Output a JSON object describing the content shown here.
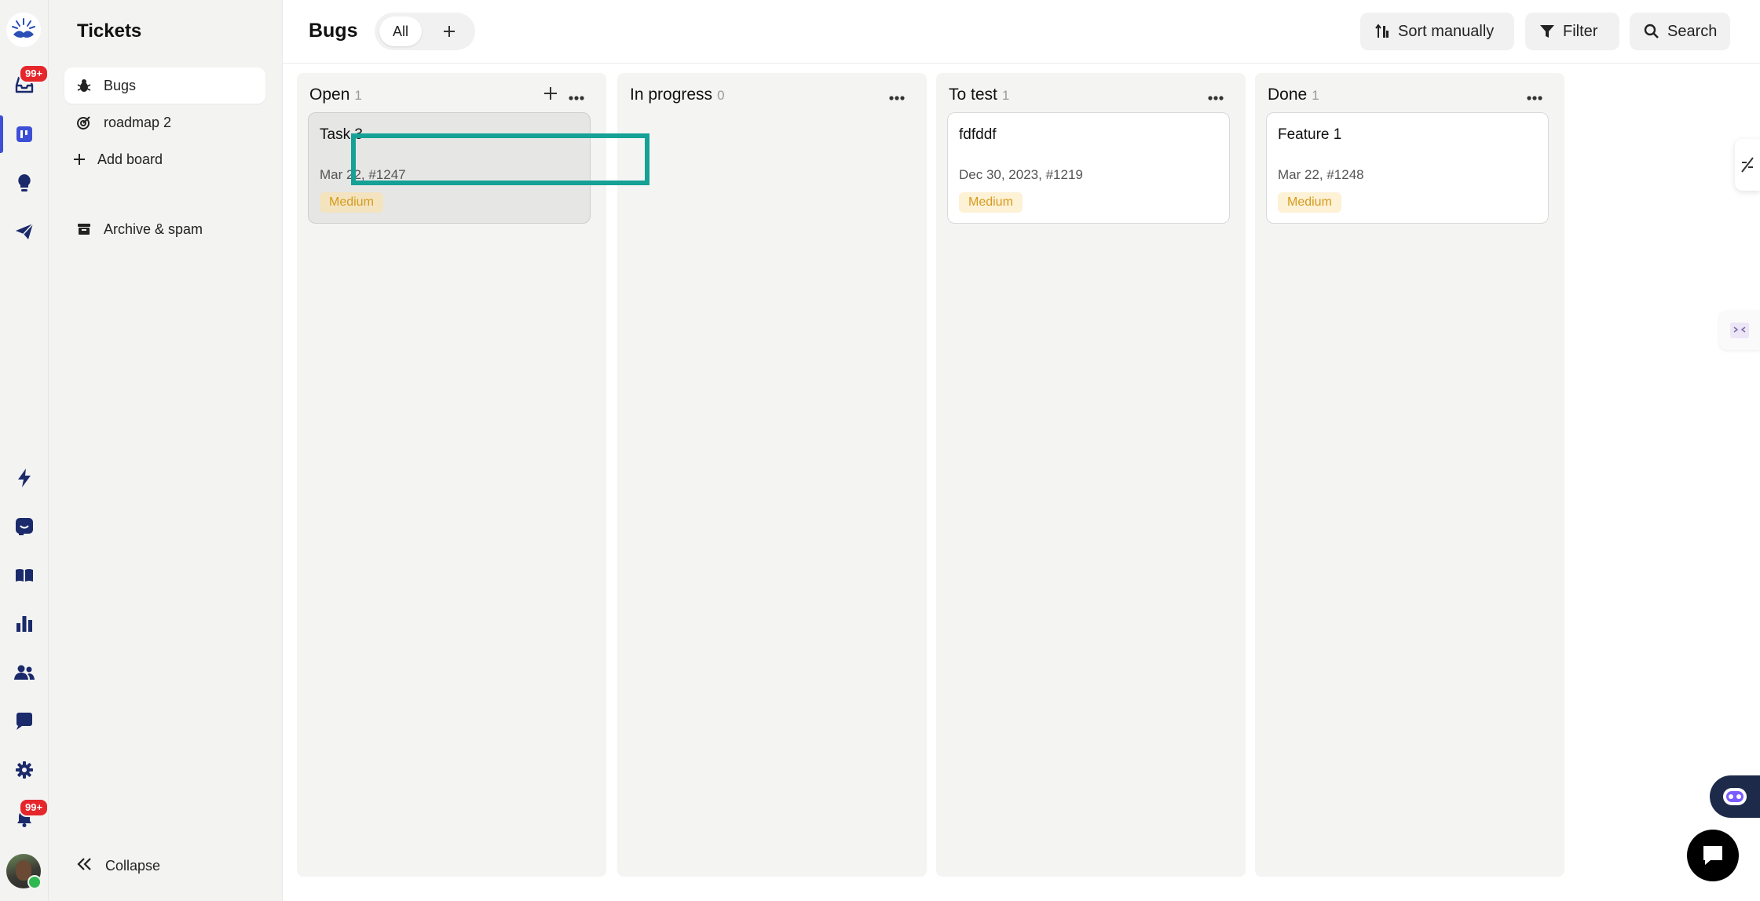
{
  "rail": {
    "inbox_badge": "99+",
    "notifications_badge": "99+",
    "icons": [
      "logo-icon",
      "inbox-icon",
      "board-icon",
      "lightbulb-icon",
      "send-icon",
      "bolt-icon",
      "smiley-icon",
      "book-icon",
      "bar-chart-icon",
      "users-icon",
      "chat-device-icon",
      "gear-icon",
      "bell-icon"
    ]
  },
  "sidebar": {
    "title": "Tickets",
    "items": [
      {
        "label": "Bugs",
        "icon": "bug-icon",
        "active": true
      },
      {
        "label": "roadmap 2",
        "icon": "target-icon",
        "active": false
      }
    ],
    "add_board": "Add board",
    "archive": "Archive & spam",
    "collapse": "Collapse"
  },
  "header": {
    "title": "Bugs",
    "tab_all": "All",
    "sort_label": "Sort manually",
    "filter_label": "Filter",
    "search_label": "Search"
  },
  "columns": [
    {
      "title": "Open",
      "count": "1",
      "cards": [
        {
          "title": "Task 3",
          "meta": "Mar 22, #1247",
          "priority": "Medium"
        }
      ]
    },
    {
      "title": "In progress",
      "count": "0",
      "cards": []
    },
    {
      "title": "To test",
      "count": "1",
      "cards": [
        {
          "title": "fdfddf",
          "meta": "Dec 30, 2023, #1219",
          "priority": "Medium"
        }
      ]
    },
    {
      "title": "Done",
      "count": "1",
      "cards": [
        {
          "title": "Feature 1",
          "meta": "Mar 22, #1248",
          "priority": "Medium"
        }
      ]
    }
  ],
  "colors": {
    "accent": "#3d4fd6",
    "badge": "#e5262b",
    "drop_outline": "#16a196",
    "priority_medium_text": "#d69a1c",
    "priority_medium_bg": "#fdf1d6"
  }
}
